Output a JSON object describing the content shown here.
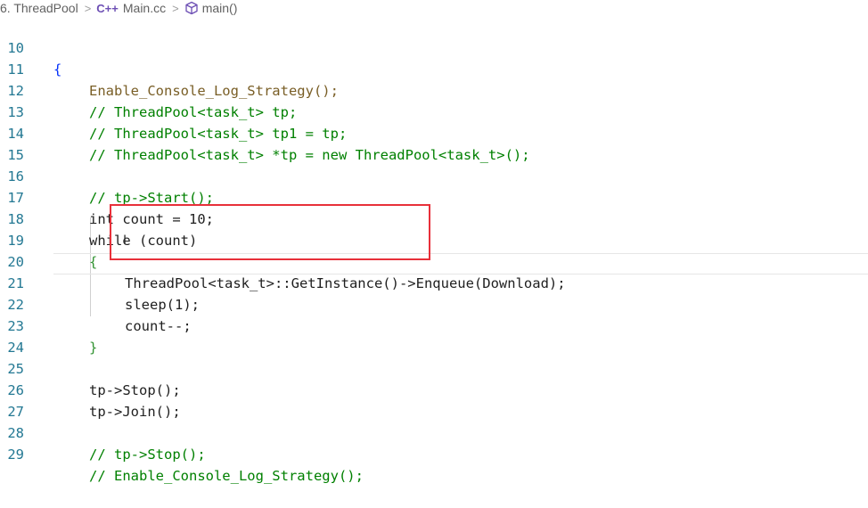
{
  "breadcrumb": {
    "items": [
      "6. ThreadPool",
      "Main.cc",
      "main()"
    ],
    "cpp_icon": "C++"
  },
  "editor": {
    "lines": [
      {
        "num": "10",
        "text": "{"
      },
      {
        "num": "11",
        "text": "Enable_Console_Log_Strategy();"
      },
      {
        "num": "12",
        "text": "// ThreadPool<task_t> tp;"
      },
      {
        "num": "13",
        "text": "// ThreadPool<task_t> tp1 = tp;"
      },
      {
        "num": "14",
        "text": "// ThreadPool<task_t> *tp = new ThreadPool<task_t>();"
      },
      {
        "num": "15",
        "text": ""
      },
      {
        "num": "16",
        "text": "// tp->Start();"
      },
      {
        "num": "17",
        "text": "int count = 10;"
      },
      {
        "num": "18",
        "text": "while (count)"
      },
      {
        "num": "19",
        "text": "{"
      },
      {
        "num": "20",
        "text": "ThreadPool<task_t>::GetInstance()->Enqueue(Download);"
      },
      {
        "num": "21",
        "text": "sleep(1);"
      },
      {
        "num": "22",
        "text": "count--;"
      },
      {
        "num": "23",
        "text": "}"
      },
      {
        "num": "24",
        "text": ""
      },
      {
        "num": "25",
        "text": "tp->Stop();"
      },
      {
        "num": "26",
        "text": "tp->Join();"
      },
      {
        "num": "27",
        "text": ""
      },
      {
        "num": "28",
        "text": "// tp->Stop();"
      },
      {
        "num": "29",
        "text": "// Enable_Console_Log_Strategy();"
      }
    ]
  },
  "colors": {
    "highlight_box": "#e8303a",
    "line_number": "#237893",
    "comment": "#008000",
    "keyword": "#0000ff"
  }
}
